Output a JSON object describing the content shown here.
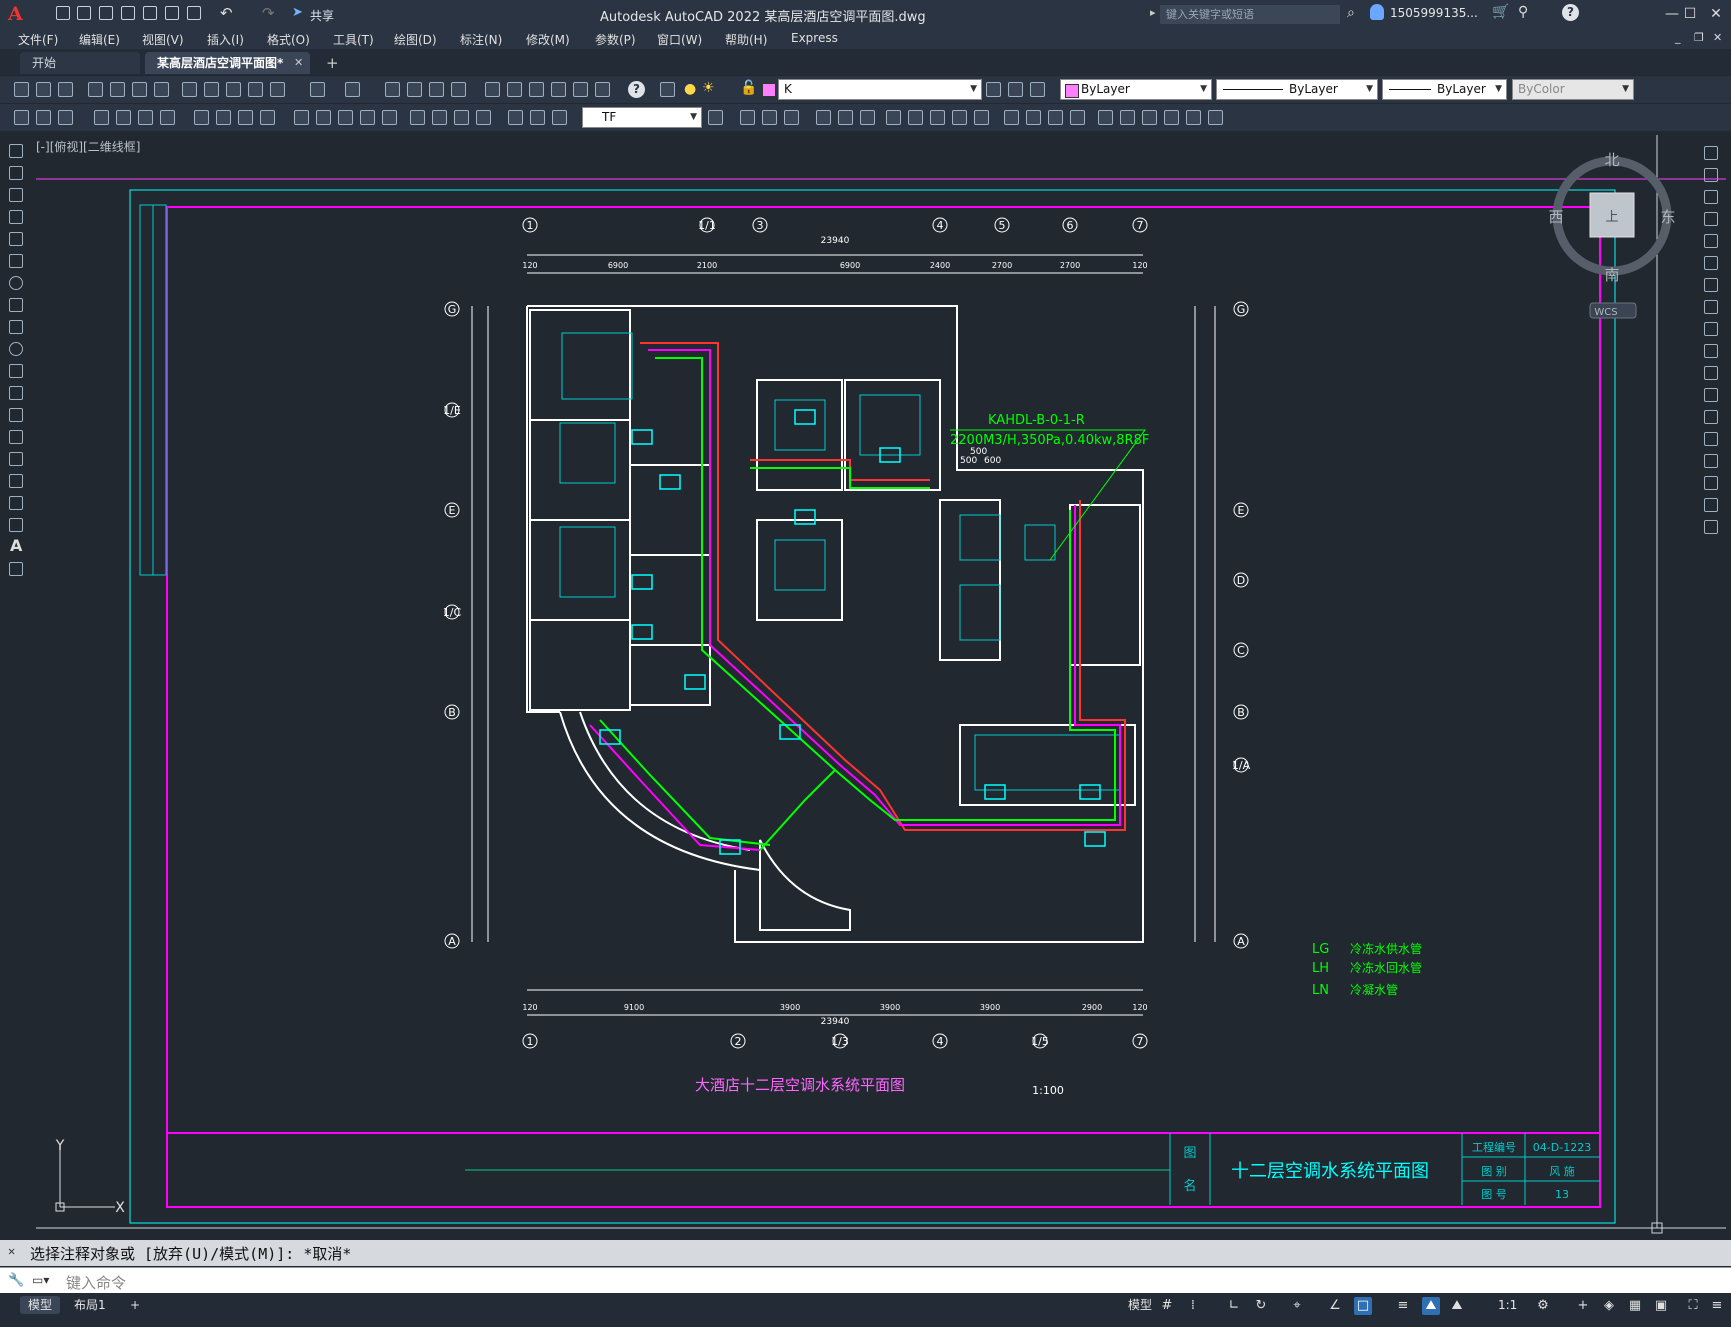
{
  "app": {
    "title": "Autodesk AutoCAD 2022    某高层酒店空调平面图.dwg",
    "share_label": "共享",
    "search_placeholder": "键入关键字或短语",
    "user": "1505999135...",
    "logo": "A"
  },
  "menu": [
    "文件(F)",
    "编辑(E)",
    "视图(V)",
    "插入(I)",
    "格式(O)",
    "工具(T)",
    "绘图(D)",
    "标注(N)",
    "修改(M)",
    "参数(P)",
    "窗口(W)",
    "帮助(H)",
    "Express"
  ],
  "tabs": {
    "start": "开始",
    "drawing": "某高层酒店空调平面图*",
    "add": "+"
  },
  "toolbar": {
    "layer": "K",
    "color": "ByLayer",
    "linetype": "ByLayer",
    "lineweight": "ByLayer",
    "plotstyle": "ByColor",
    "textstyle": "TF"
  },
  "viewport_label": "[-][俯视][二维线框]",
  "viewcube": {
    "north": "北",
    "south": "南",
    "east": "东",
    "west": "西",
    "top": "上",
    "wcs": "WCS"
  },
  "ucs": {
    "y": "Y",
    "x": "X"
  },
  "drawing": {
    "top_grid": [
      "1",
      "1/1",
      "3",
      "4",
      "5",
      "6",
      "7"
    ],
    "bottom_grid": [
      "1",
      "2",
      "1/3",
      "4",
      "1/5",
      "7"
    ],
    "left_grid": [
      "G",
      "1/E",
      "E",
      "1/C",
      "B",
      "A"
    ],
    "right_grid": [
      "G",
      "E",
      "D",
      "C",
      "B",
      "1/A",
      "A"
    ],
    "top_total": "23940",
    "bottom_total": "23940",
    "top_dims": [
      "120",
      "6900",
      "2100",
      "6900",
      "2400",
      "2700",
      "2700",
      "120"
    ],
    "bottom_dims": [
      "120",
      "9100",
      "3900",
      "3900",
      "3900",
      "2900",
      "120"
    ],
    "equipment_label": "KAHDL-B-0-1-R",
    "equipment_spec": "2200M3/H,350Pa,0.40kw,8R8F",
    "dim_500": "500",
    "dim_600": "600",
    "caption": "大酒店十二层空调水系统平面图",
    "scale": "1:100",
    "legend": [
      {
        "code": "LG",
        "desc": "冷冻水供水管"
      },
      {
        "code": "LH",
        "desc": "冷冻水回水管"
      },
      {
        "code": "LN",
        "desc": "冷凝水管"
      }
    ],
    "titleblock": {
      "name_label_1": "图",
      "name_label_2": "名",
      "sheet_title": "十二层空调水系统平面图",
      "proj_label": "工程编号",
      "proj_value": "04-D-1223",
      "type_label": "图  别",
      "type_value": "风 施",
      "num_label": "图  号",
      "num_value": "13"
    }
  },
  "command": {
    "history": "选择注释对象或 [放弃(U)/模式(M)]: *取消*",
    "placeholder": "键入命令"
  },
  "status": {
    "model_tab": "模型",
    "layout_tab": "布局1",
    "add": "+",
    "model_label": "模型",
    "scale": "1:1"
  }
}
